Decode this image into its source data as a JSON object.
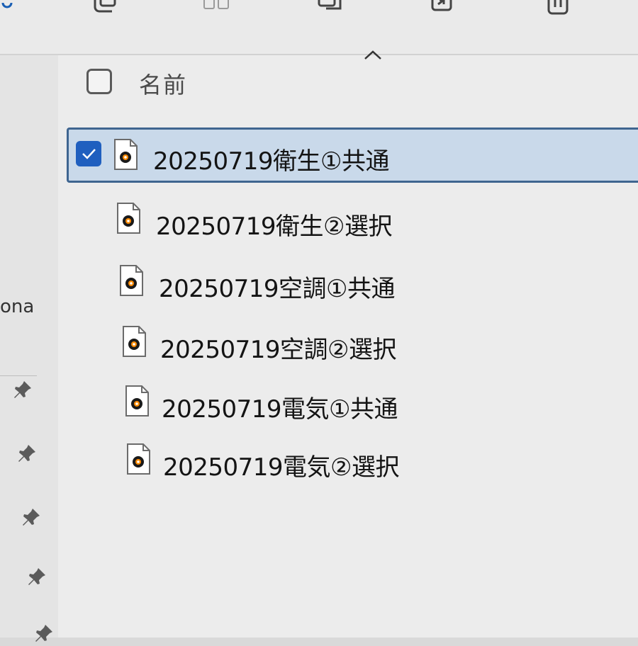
{
  "nav": {
    "partial_label": "ona"
  },
  "list": {
    "header": {
      "name_label": "名前"
    },
    "files": [
      {
        "name": "20250719衛生①共通",
        "selected": true
      },
      {
        "name": "20250719衛生②選択",
        "selected": false
      },
      {
        "name": "20250719空調①共通",
        "selected": false
      },
      {
        "name": "20250719空調②選択",
        "selected": false
      },
      {
        "name": "20250719電気①共通",
        "selected": false
      },
      {
        "name": "20250719電気②選択",
        "selected": false
      }
    ]
  },
  "icons": {
    "toolbar": [
      "new-icon",
      "copy-icon",
      "paste-icon",
      "share-icon",
      "delete-icon"
    ],
    "file": "media-file-icon",
    "pin": "pin-icon",
    "sort": "chevron-up-icon"
  },
  "colors": {
    "selection_bg": "#c9d9ea",
    "selection_border": "#3f6590",
    "checkbox_checked": "#1f5fbf"
  }
}
